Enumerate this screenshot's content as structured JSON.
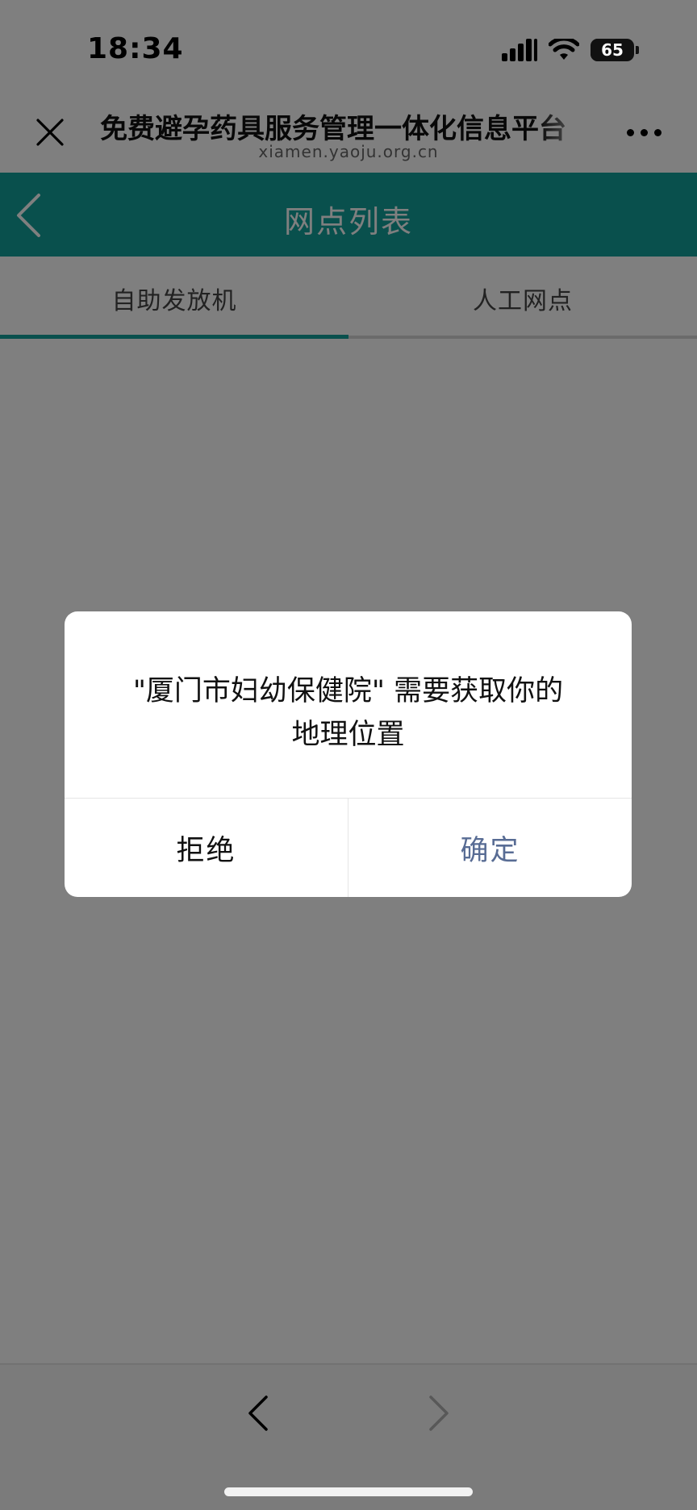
{
  "status_bar": {
    "time": "18:34",
    "battery": "65"
  },
  "webview_header": {
    "title": "免费避孕药具服务管理一体化信息平台",
    "domain": "xiamen.yaoju.org.cn"
  },
  "app_nav": {
    "title": "网点列表"
  },
  "tabs": [
    {
      "label": "自助发放机",
      "active": true
    },
    {
      "label": "人工网点",
      "active": false
    }
  ],
  "dialog": {
    "line1": "\"厦门市妇幼保健院\" 需要获取你的",
    "line2": "地理位置",
    "reject_label": "拒绝",
    "confirm_label": "确定"
  },
  "colors": {
    "accent": "#12a09a",
    "confirm_text": "#586c94"
  }
}
